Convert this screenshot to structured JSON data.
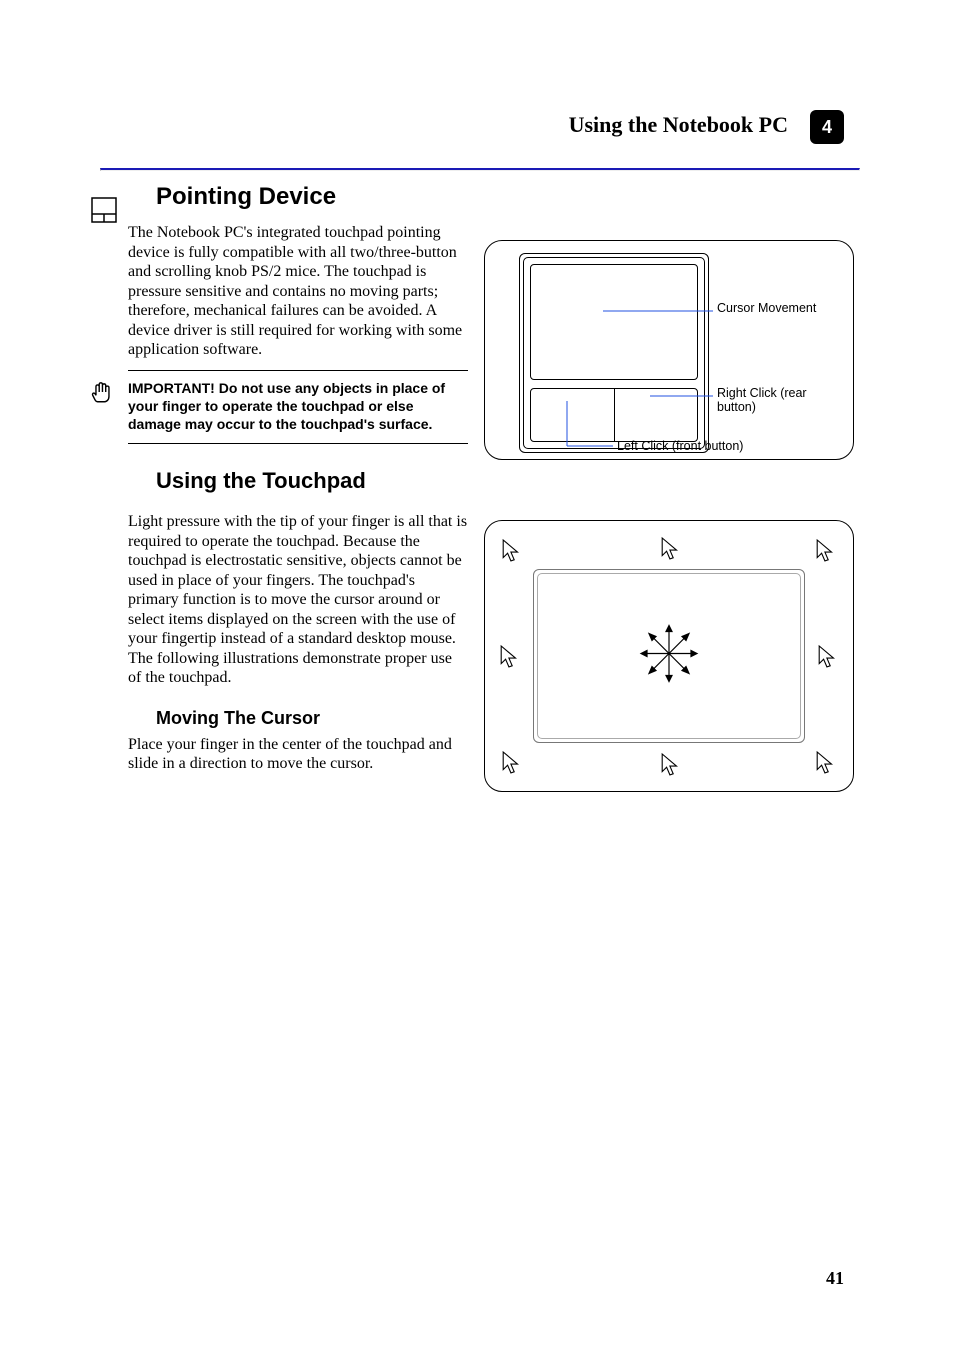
{
  "header": {
    "title": "Using the Notebook PC"
  },
  "pointing": {
    "heading": "Pointing Device",
    "p1": "The Notebook PC's integrated touchpad pointing device is fully compatible with all two/three-button and scrolling knob PS/2 mice. The touchpad is pressure sensitive and contains no moving parts; therefore, mechanical failures can be avoided. A device driver is still required for working with some application software.",
    "callout": "IMPORTANT! Do not use any objects in place of your finger to operate the touchpad or else damage may occur to the touchpad's surface.",
    "diagram": {
      "cursor_move": "Cursor Movement",
      "right_click": "Right Click (rear button)",
      "left_click": "Left Click (front button)"
    }
  },
  "usage": {
    "heading": "Using the Touchpad",
    "p1": "Light pressure with the tip of your finger is all that is required to operate the touchpad. Because the touchpad is electrostatic sensitive, objects cannot be used in place of your fingers. The touchpad's primary function is to move the cursor around or select items displayed on the screen with the use of your fingertip instead of a standard desktop mouse. The following illustrations demonstrate proper use of the touchpad.",
    "h3": "Moving The Cursor",
    "p2": "Place your finger in the center of the touchpad and slide in a direction to move the cursor."
  },
  "section_badge": "4",
  "page_number": "41"
}
